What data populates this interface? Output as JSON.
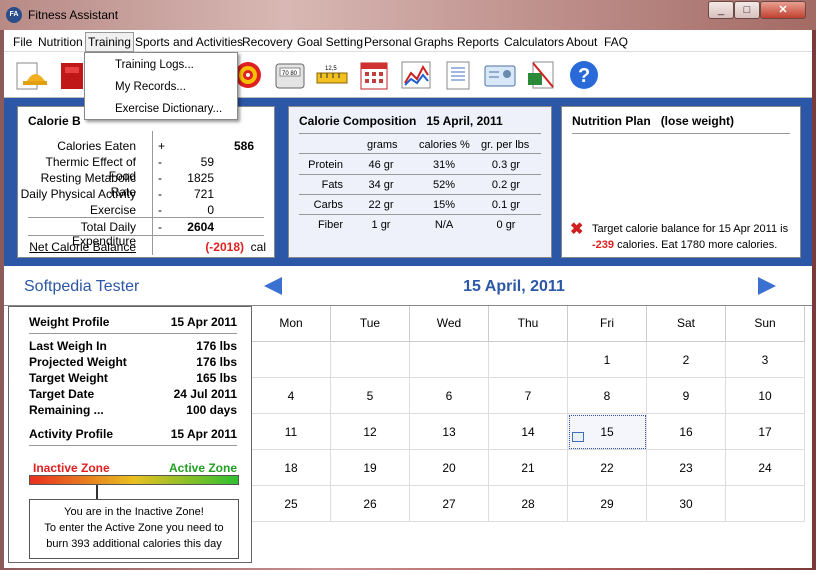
{
  "window": {
    "title": "Fitness Assistant",
    "icon_text": "FA",
    "minimize": "_",
    "maximize": "□",
    "close": "✕"
  },
  "menu": [
    "File",
    "Nutrition",
    "Training",
    "Sports and Activities",
    "Recovery",
    "Goal Setting",
    "Personal",
    "Graphs",
    "Reports",
    "Calculators",
    "About",
    "FAQ"
  ],
  "dropdown": [
    "Training Logs...",
    "My Records...",
    "Exercise Dictionary..."
  ],
  "calorie_balance": {
    "title": "Calorie B",
    "rows": [
      {
        "label": "Calories Eaten",
        "sign": "+",
        "value": "586",
        "bold": true
      },
      {
        "label": "Thermic Effect of Food",
        "sign": "-",
        "value": "59"
      },
      {
        "label": "Resting Metabolic Rate",
        "sign": "-",
        "value": "1825"
      },
      {
        "label": "Daily Physical Activity",
        "sign": "-",
        "value": "721"
      },
      {
        "label": "Exercise",
        "sign": "-",
        "value": "0"
      },
      {
        "label": "Total Daily Expenditure",
        "sign": "-",
        "value": "2604",
        "bold": true
      }
    ],
    "net_label": "Net Calorie Balance",
    "net_value": "(-2018)",
    "net_unit": "cal"
  },
  "composition": {
    "title": "Calorie Composition",
    "date": "15 April, 2011",
    "headers": [
      "grams",
      "calories %",
      "gr. per lbs"
    ],
    "rows": [
      [
        "Protein",
        "46 gr",
        "31%",
        "0.3 gr"
      ],
      [
        "Fats",
        "34 gr",
        "52%",
        "0.2 gr"
      ],
      [
        "Carbs",
        "22 gr",
        "15%",
        "0.1 gr"
      ],
      [
        "Fiber",
        "1 gr",
        "N/A",
        "0 gr"
      ]
    ]
  },
  "nutrition_plan": {
    "title": "Nutrition Plan",
    "subtitle": "(lose weight)",
    "message_pre": "Target calorie balance for 15 Apr 2011 is",
    "message_value": "-239",
    "message_post": "calories. Eat 1780 more calories."
  },
  "user_name": "Softpedia Tester",
  "current_date": "15 April, 2011",
  "weight_profile": {
    "title": "Weight Profile",
    "date": "15 Apr 2011",
    "rows": [
      {
        "label": "Last Weigh In",
        "value": "176 lbs"
      },
      {
        "label": "Projected Weight",
        "value": "176 lbs"
      },
      {
        "label": "Target Weight",
        "value": "165 lbs"
      },
      {
        "label": "Target Date",
        "value": "24 Jul 2011"
      },
      {
        "label": "Remaining ...",
        "value": "100 days"
      }
    ]
  },
  "activity_profile": {
    "title": "Activity Profile",
    "date": "15 Apr 2011",
    "inactive_label": "Inactive Zone",
    "active_label": "Active Zone",
    "level": 0.32,
    "message_line1": "You are in the Inactive Zone!",
    "message_line2": "To enter the Active Zone you need to",
    "message_line3": "burn 393 additional calories this day"
  },
  "calendar": {
    "days": [
      "Mon",
      "Tue",
      "Wed",
      "Thu",
      "Fri",
      "Sat",
      "Sun"
    ],
    "weeks": [
      [
        "",
        "",
        "",
        "",
        "1",
        "2",
        "3"
      ],
      [
        "4",
        "5",
        "6",
        "7",
        "8",
        "9",
        "10"
      ],
      [
        "11",
        "12",
        "13",
        "14",
        "15",
        "16",
        "17"
      ],
      [
        "18",
        "19",
        "20",
        "21",
        "22",
        "23",
        "24"
      ],
      [
        "25",
        "26",
        "27",
        "28",
        "29",
        "30",
        ""
      ]
    ],
    "selected": "15"
  },
  "colors": {
    "accent_blue": "#2b57a6",
    "red": "#e02020",
    "green": "#22a022"
  }
}
